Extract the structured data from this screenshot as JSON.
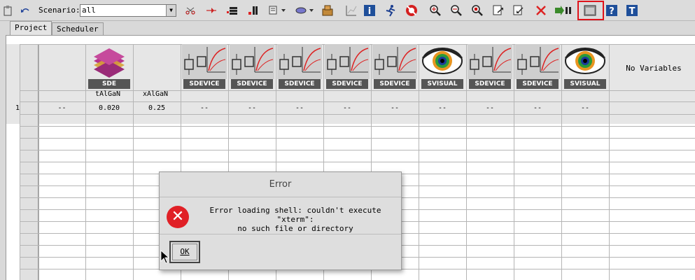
{
  "toolbar": {
    "scenario_label": "Scenario:",
    "scenario_value": "all",
    "icons": [
      "clipboard-icon",
      "undo-icon",
      "cut-icon",
      "paste-icon",
      "add-row-icon",
      "add-column-icon",
      "view-menu-icon",
      "filter-menu-icon",
      "package-icon",
      "chart-icon",
      "info-icon",
      "run-icon",
      "stop-icon",
      "zoom-in-icon",
      "zoom-out-icon",
      "zoom-fit-icon",
      "export-icon",
      "import-icon",
      "prune-icon",
      "preprocess-icon",
      "terminal-icon",
      "help-icon",
      "text-icon"
    ]
  },
  "tabs": [
    "Project",
    "Scheduler"
  ],
  "tools": [
    {
      "label": "SDE",
      "kind": "sde"
    },
    {
      "label": "SDEVICE",
      "kind": "device"
    },
    {
      "label": "SDEVICE",
      "kind": "device"
    },
    {
      "label": "SDEVICE",
      "kind": "device"
    },
    {
      "label": "SDEVICE",
      "kind": "device"
    },
    {
      "label": "SDEVICE",
      "kind": "device"
    },
    {
      "label": "SVISUAL",
      "kind": "visual"
    },
    {
      "label": "SDEVICE",
      "kind": "device"
    },
    {
      "label": "SDEVICE",
      "kind": "device"
    },
    {
      "label": "SVISUAL",
      "kind": "visual"
    }
  ],
  "parameters": [
    "tAlGaN",
    "xAlGaN"
  ],
  "no_variables": "No Variables",
  "rows": [
    {
      "num": "1",
      "cells": [
        "--",
        "0.020",
        "0.25",
        "--",
        "--",
        "--",
        "--",
        "--",
        "--",
        "--",
        "--",
        "--"
      ]
    }
  ],
  "dialog": {
    "title": "Error",
    "message": "Error loading shell: couldn't execute \"xterm\":\nno such file or directory",
    "ok_label": "OK"
  },
  "colors": {
    "highlight": "#e0121a",
    "error": "#e02026"
  }
}
